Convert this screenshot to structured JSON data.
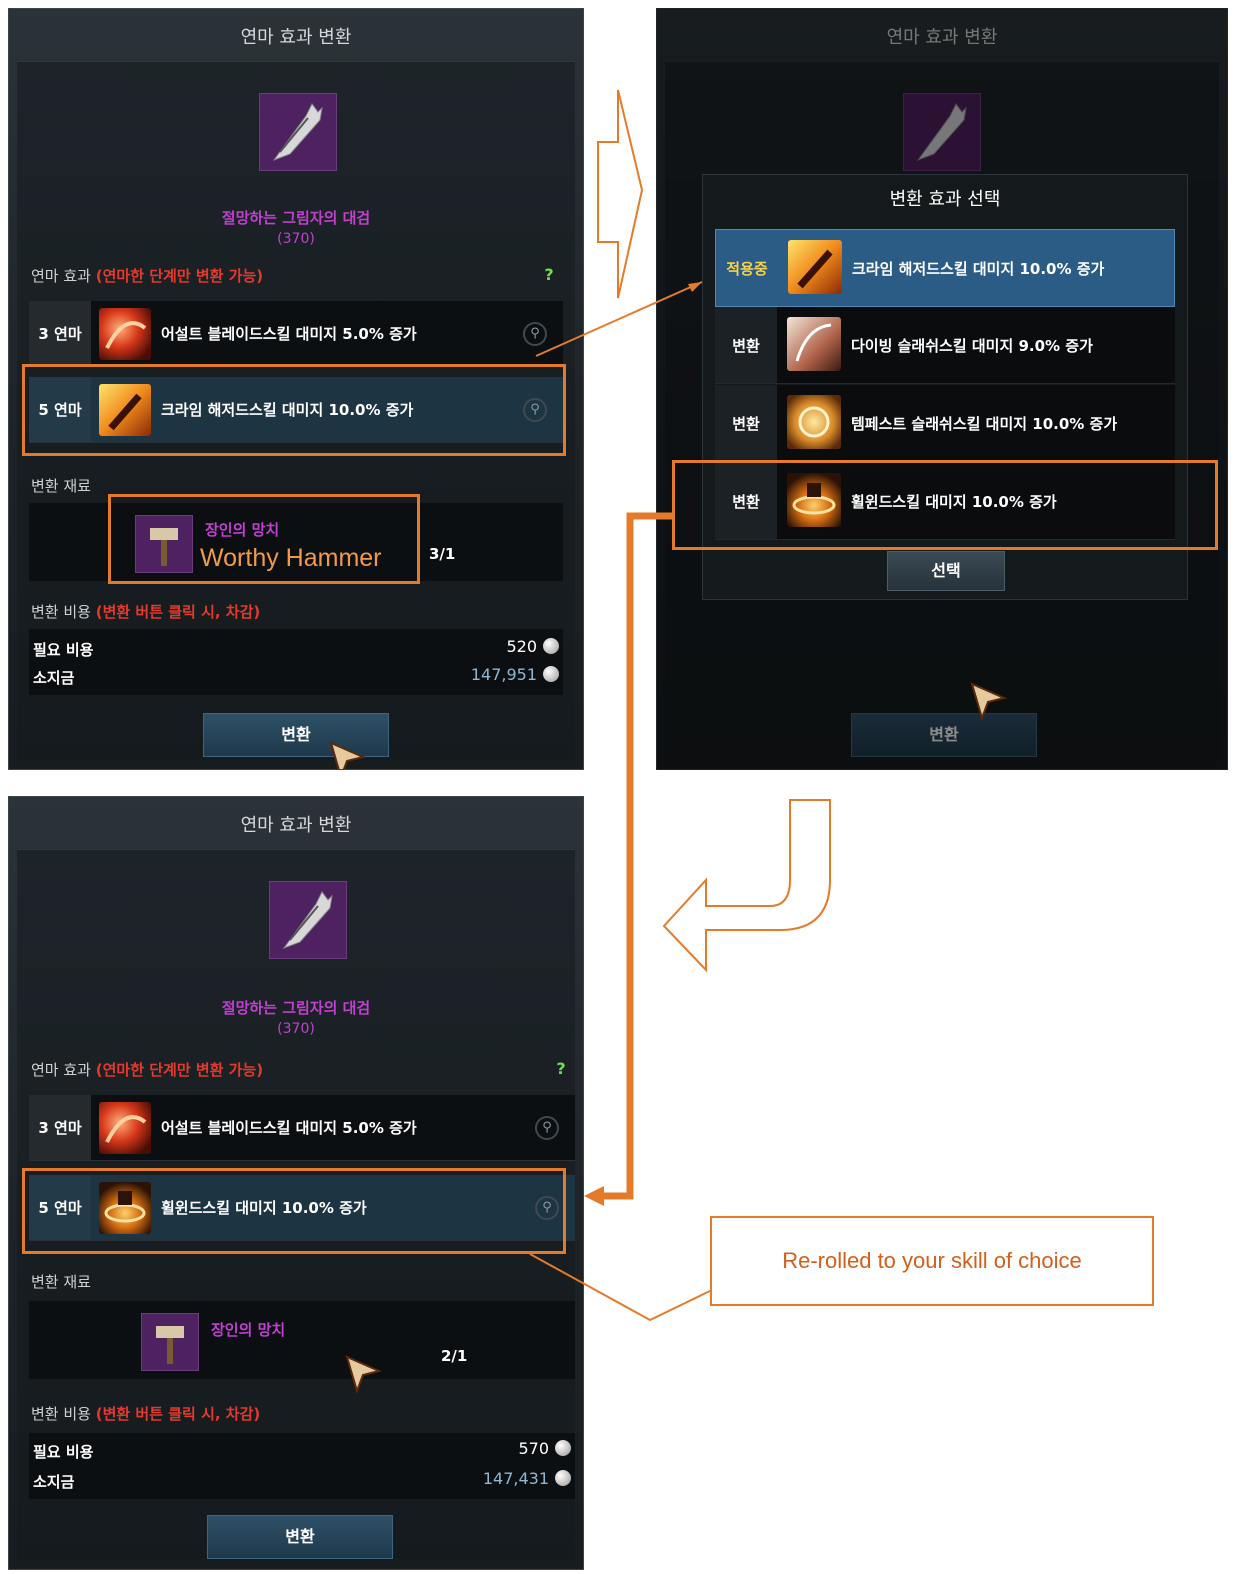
{
  "panel_title": "연마 효과 변환",
  "weapon": {
    "name": "절망하는 그림자의 대검",
    "level": "(370)"
  },
  "effects_label": "연마 효과",
  "effects_note": "(연마한 단계만 변환 가능)",
  "help_icon": "?",
  "material_label": "변환 재료",
  "material_name": "장인의 망치",
  "material_overlay": "Worthy Hammer",
  "cost_label": "변환 비용",
  "cost_note": "(변환 버튼 클릭 시, 차감)",
  "required_cost_label": "필요 비용",
  "owned_label": "소지금",
  "convert_button": "변환",
  "before": {
    "rows": [
      {
        "level": "3 연마",
        "text": "어설트 블레이드스킬 대미지 5.0% 증가",
        "icon": "assault-blade-skill-icon"
      },
      {
        "level": "5 연마",
        "text": "크라임 해저드스킬 대미지 10.0% 증가",
        "icon": "crime-hazard-skill-icon"
      }
    ],
    "material_count": "3/1",
    "required_cost": "520",
    "owned": "147,951"
  },
  "popup": {
    "title": "변환 효과 선택",
    "rows": [
      {
        "tag": "적용중",
        "text": "크라임 해저드스킬 대미지 10.0% 증가",
        "icon": "crime-hazard-skill-icon"
      },
      {
        "tag": "변환",
        "text": "다이빙 슬래쉬스킬 대미지 9.0% 증가",
        "icon": "diving-slash-skill-icon"
      },
      {
        "tag": "변환",
        "text": "템페스트 슬래쉬스킬 대미지 10.0% 증가",
        "icon": "tempest-slash-skill-icon"
      },
      {
        "tag": "변환",
        "text": "휠윈드스킬 대미지 10.0% 증가",
        "icon": "whirlwind-skill-icon"
      }
    ],
    "select_button": "선택"
  },
  "after": {
    "rows": [
      {
        "level": "3 연마",
        "text": "어설트 블레이드스킬 대미지 5.0% 증가",
        "icon": "assault-blade-skill-icon"
      },
      {
        "level": "5 연마",
        "text": "휠윈드스킬 대미지 10.0% 증가",
        "icon": "whirlwind-skill-icon"
      }
    ],
    "material_count": "2/1",
    "required_cost": "570",
    "owned": "147,431"
  },
  "callout": "Re-rolled to your skill of choice",
  "colors": {
    "accent": "#e47b2b",
    "weapon_name": "#c040d0",
    "warning": "#e23b2e",
    "active_row": "#2b5c86"
  }
}
